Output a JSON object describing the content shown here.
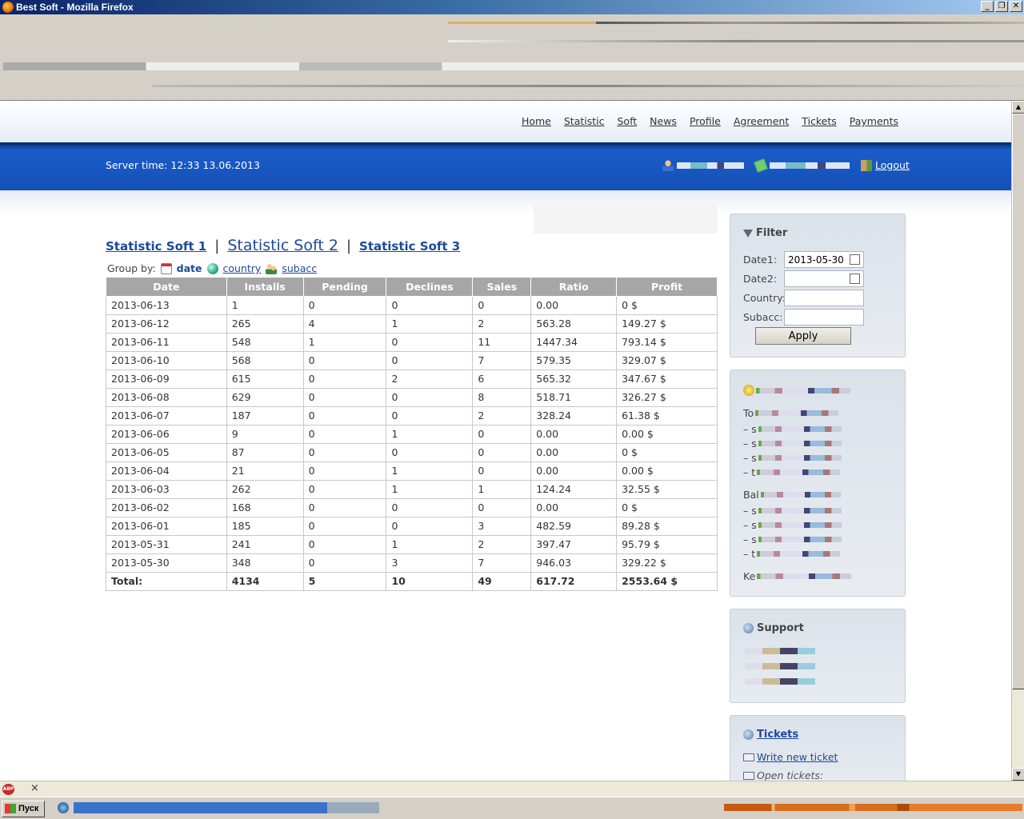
{
  "window": {
    "title": "Best Soft - Mozilla Firefox",
    "btn_min": "_",
    "btn_max": "❐",
    "btn_close": "✕"
  },
  "nav": {
    "items": [
      "Home",
      "Statistic",
      "Soft",
      "News",
      "Profile",
      "Agreement",
      "Tickets",
      "Payments"
    ]
  },
  "header": {
    "server_time": "Server time: 12:33 13.06.2013",
    "logout": "Logout"
  },
  "tabs": {
    "tab1": "Statistic Soft 1",
    "tab2": "Statistic Soft 2",
    "tab3": "Statistic Soft 3",
    "separator": "|"
  },
  "groupby": {
    "label": "Group by:",
    "date": "date",
    "country": "country",
    "subacc": "subacc"
  },
  "table": {
    "columns": [
      "Date",
      "Installs",
      "Pending",
      "Declines",
      "Sales",
      "Ratio",
      "Profit"
    ],
    "rows": [
      [
        "2013-06-13",
        "1",
        "0",
        "0",
        "0",
        "0.00",
        "0 $"
      ],
      [
        "2013-06-12",
        "265",
        "4",
        "1",
        "2",
        "563.28",
        "149.27 $"
      ],
      [
        "2013-06-11",
        "548",
        "1",
        "0",
        "11",
        "1447.34",
        "793.14 $"
      ],
      [
        "2013-06-10",
        "568",
        "0",
        "0",
        "7",
        "579.35",
        "329.07 $"
      ],
      [
        "2013-06-09",
        "615",
        "0",
        "2",
        "6",
        "565.32",
        "347.67 $"
      ],
      [
        "2013-06-08",
        "629",
        "0",
        "0",
        "8",
        "518.71",
        "326.27 $"
      ],
      [
        "2013-06-07",
        "187",
        "0",
        "0",
        "2",
        "328.24",
        "61.38 $"
      ],
      [
        "2013-06-06",
        "9",
        "0",
        "1",
        "0",
        "0.00",
        "0.00 $"
      ],
      [
        "2013-06-05",
        "87",
        "0",
        "0",
        "0",
        "0.00",
        "0 $"
      ],
      [
        "2013-06-04",
        "21",
        "0",
        "1",
        "0",
        "0.00",
        "0.00 $"
      ],
      [
        "2013-06-03",
        "262",
        "0",
        "1",
        "1",
        "124.24",
        "32.55 $"
      ],
      [
        "2013-06-02",
        "168",
        "0",
        "0",
        "0",
        "0.00",
        "0 $"
      ],
      [
        "2013-06-01",
        "185",
        "0",
        "0",
        "3",
        "482.59",
        "89.28 $"
      ],
      [
        "2013-05-31",
        "241",
        "0",
        "1",
        "2",
        "397.47",
        "95.79 $"
      ],
      [
        "2013-05-30",
        "348",
        "0",
        "3",
        "7",
        "946.03",
        "329.22 $"
      ]
    ],
    "total": [
      "Total:",
      "4134",
      "5",
      "10",
      "49",
      "617.72",
      "2553.64 $"
    ]
  },
  "filter": {
    "title": "Filter",
    "date1_label": "Date1:",
    "date1_value": "2013-05-30",
    "date2_label": "Date2:",
    "date2_value": "",
    "country_label": "Country:",
    "country_value": "",
    "subacc_label": "Subacc:",
    "subacc_value": "",
    "apply": "Apply"
  },
  "balance": {
    "lines": [
      "To",
      "– s",
      "– s",
      "– s",
      "– t",
      "Bal",
      "– s",
      "– s",
      "– s",
      "– t",
      "Ke"
    ]
  },
  "support": {
    "title": "Support"
  },
  "tickets": {
    "title": "Tickets",
    "write_new": "Write new ticket",
    "open": "Open tickets:"
  },
  "taskbar": {
    "start": "Пуск"
  },
  "statusbar": {
    "abp": "ABP",
    "close": "×"
  },
  "icons": [
    "firefox-icon",
    "user-icon",
    "money-icon",
    "logout-icon",
    "calendar-icon",
    "globe-icon",
    "users-icon",
    "filter-icon",
    "coins-icon",
    "help-icon",
    "envelope-icon"
  ]
}
